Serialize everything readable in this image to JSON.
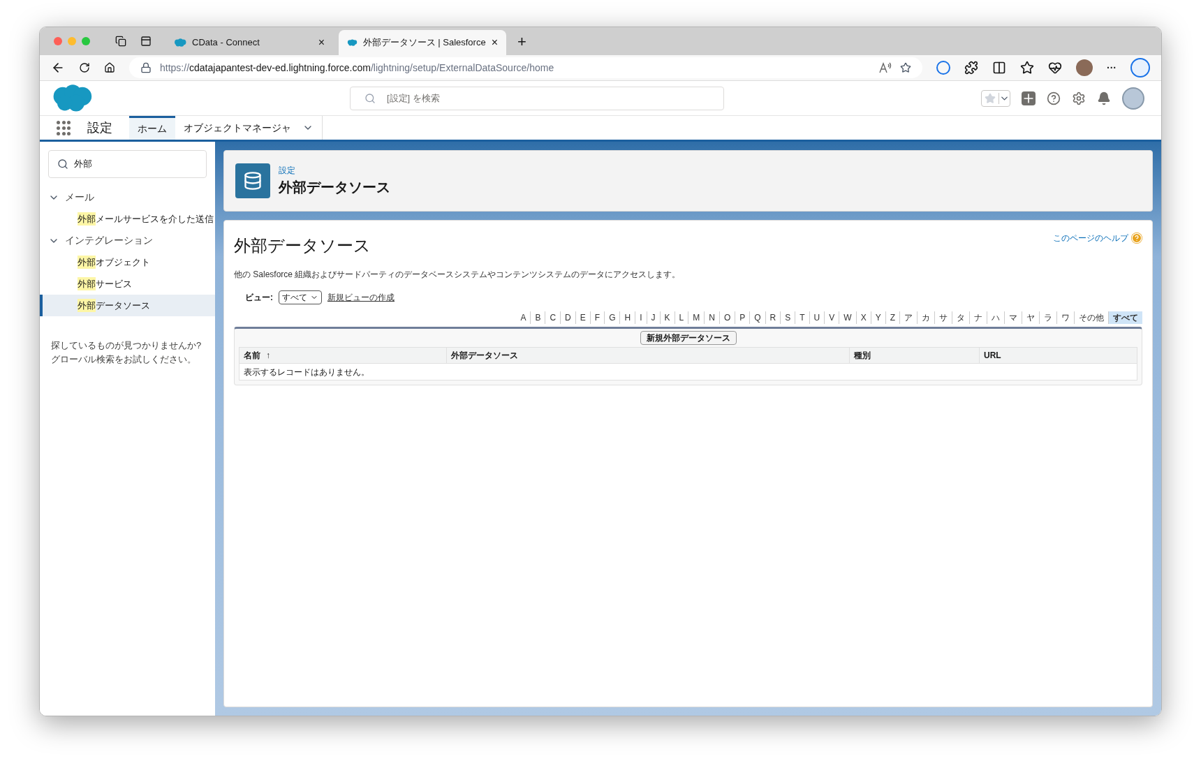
{
  "browser": {
    "tabs": [
      {
        "title": "CData - Connect",
        "selected": false,
        "close": "×"
      },
      {
        "title": "外部データソース | Salesforce",
        "selected": true,
        "close": "×"
      }
    ],
    "new_tab": "+",
    "url_scheme": "https://",
    "url_host": "cdatajapantest-dev-ed.lightning.force.com",
    "url_path": "/lightning/setup/ExternalDataSource/home",
    "more": "···"
  },
  "header": {
    "search_placeholder": "[設定] を検索"
  },
  "nav": {
    "app_name": "設定",
    "tabs": [
      {
        "label": "ホーム",
        "selected": true,
        "dropdown": false
      },
      {
        "label": "オブジェクトマネージャ",
        "selected": false,
        "dropdown": true
      }
    ]
  },
  "sidebar": {
    "search_value": "外部",
    "tree": [
      {
        "label": "メール",
        "expanded": true,
        "children": [
          {
            "match": "外部",
            "label": "メールサービスを介した送信",
            "selected": false
          }
        ]
      },
      {
        "label": "インテグレーション",
        "expanded": true,
        "children": [
          {
            "match": "外部",
            "label": "オブジェクト",
            "selected": false
          },
          {
            "match": "外部",
            "label": "サービス",
            "selected": false
          },
          {
            "match": "外部",
            "label": "データソース",
            "selected": true
          }
        ]
      }
    ],
    "help_text": "探しているものが見つかりませんか? グローバル検索をお試しください。"
  },
  "page_header": {
    "breadcrumb": "設定",
    "title": "外部データソース"
  },
  "content": {
    "title": "外部データソース",
    "help_link": "このページのヘルプ",
    "description": "他の Salesforce 組織およびサードパーティのデータベースシステムやコンテンツシステムのデータにアクセスします。",
    "view_label": "ビュー:",
    "view_value": "すべて",
    "create_view_link": "新規ビューの作成",
    "letters": [
      {
        "label": "A",
        "selected": false
      },
      {
        "label": "B",
        "selected": false
      },
      {
        "label": "C",
        "selected": false
      },
      {
        "label": "D",
        "selected": false
      },
      {
        "label": "E",
        "selected": false
      },
      {
        "label": "F",
        "selected": false
      },
      {
        "label": "G",
        "selected": false
      },
      {
        "label": "H",
        "selected": false
      },
      {
        "label": "I",
        "selected": false
      },
      {
        "label": "J",
        "selected": false
      },
      {
        "label": "K",
        "selected": false
      },
      {
        "label": "L",
        "selected": false
      },
      {
        "label": "M",
        "selected": false
      },
      {
        "label": "N",
        "selected": false
      },
      {
        "label": "O",
        "selected": false
      },
      {
        "label": "P",
        "selected": false
      },
      {
        "label": "Q",
        "selected": false
      },
      {
        "label": "R",
        "selected": false
      },
      {
        "label": "S",
        "selected": false
      },
      {
        "label": "T",
        "selected": false
      },
      {
        "label": "U",
        "selected": false
      },
      {
        "label": "V",
        "selected": false
      },
      {
        "label": "W",
        "selected": false
      },
      {
        "label": "X",
        "selected": false
      },
      {
        "label": "Y",
        "selected": false
      },
      {
        "label": "Z",
        "selected": false
      },
      {
        "label": "ア",
        "selected": false
      },
      {
        "label": "カ",
        "selected": false
      },
      {
        "label": "サ",
        "selected": false
      },
      {
        "label": "タ",
        "selected": false
      },
      {
        "label": "ナ",
        "selected": false
      },
      {
        "label": "ハ",
        "selected": false
      },
      {
        "label": "マ",
        "selected": false
      },
      {
        "label": "ヤ",
        "selected": false
      },
      {
        "label": "ラ",
        "selected": false
      },
      {
        "label": "ワ",
        "selected": false
      },
      {
        "label": "その他",
        "selected": false
      },
      {
        "label": "すべて",
        "selected": true
      }
    ],
    "new_button": "新規外部データソース",
    "table": {
      "columns": [
        {
          "label": "名前",
          "sort": "↑"
        },
        {
          "label": "外部データソース"
        },
        {
          "label": "種別"
        },
        {
          "label": "URL"
        }
      ],
      "empty_message": "表示するレコードはありません。"
    }
  }
}
